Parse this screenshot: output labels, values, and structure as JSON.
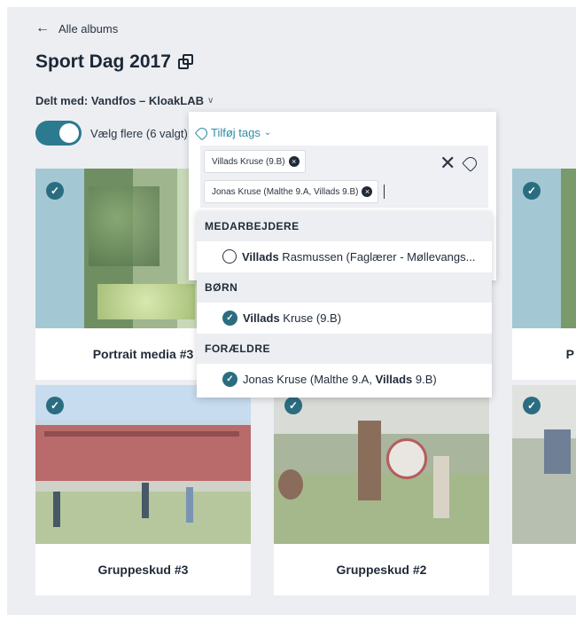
{
  "nav": {
    "back_label": "Alle albums"
  },
  "album": {
    "title": "Sport Dag 2017"
  },
  "sharing": {
    "label": "Delt med: Vandfos – KloakLAB"
  },
  "selection": {
    "toggle_on": true,
    "label": "Vælg flere (6 valgt)"
  },
  "tags": {
    "button_label": "Tilføj tags",
    "selected_chips": [
      "Villads Kruse (9.B)",
      "Jonas Kruse (Malthe 9.A, Villads 9.B)"
    ]
  },
  "dropdown": {
    "groups": [
      {
        "header": "MEDARBEJDERE",
        "items": [
          {
            "bold": "Villads",
            "rest": " Rasmussen (Faglærer - Møllevangs...",
            "checked": false
          }
        ]
      },
      {
        "header": "BØRN",
        "items": [
          {
            "bold": "Villads",
            "rest": " Kruse (9.B)",
            "checked": true
          }
        ]
      },
      {
        "header": "FORÆLDRE",
        "items": [
          {
            "pre": "Jonas Kruse (Malthe 9.A, ",
            "bold": "Villads",
            "rest": " 9.B)",
            "checked": true
          }
        ]
      }
    ]
  },
  "media": [
    {
      "caption": "Portrait media #3",
      "selected": true
    },
    {
      "caption": "P",
      "selected": true
    },
    {
      "caption": "Gruppeskud #3",
      "selected": true
    },
    {
      "caption": "Gruppeskud #2",
      "selected": true
    },
    {
      "caption": "",
      "selected": true
    }
  ],
  "colors": {
    "accent": "#2b7a8f",
    "link": "#2f8aa6",
    "check": "#2b6d80"
  }
}
